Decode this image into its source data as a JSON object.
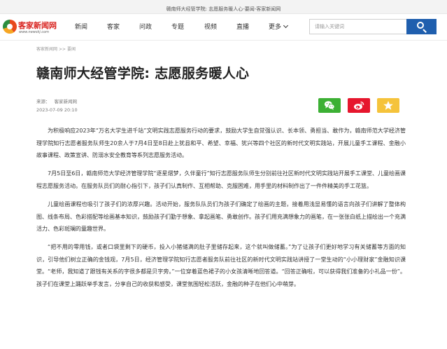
{
  "window_title": "赣南师大经管学院: 志愿服务暖人心-要闻-客家新闻网",
  "logo": {
    "name": "客家新闻网",
    "url": "www.newskj.com"
  },
  "nav": [
    "新闻",
    "客家",
    "问政",
    "专题",
    "视频",
    "直播",
    "更多"
  ],
  "search": {
    "placeholder": "请输入关键词",
    "value": ""
  },
  "breadcrumb": {
    "home": "客家新闻网",
    "separator": ">>",
    "section": "要闻"
  },
  "article": {
    "title": "赣南师大经管学院: 志愿服务暖人心",
    "source_label": "来源：",
    "source": "客家新闻网",
    "date": "2023-07-09 20:10",
    "paragraphs": [
      "为积极响应2023年“万名大学生进千站”文明实践志愿服务行动的要求，鼓励大学生自觉强认识、长本领、勇担当、敢作为，赣南师范大学经济管理学院知行志愿者服务队师生20余人于7月4日至8日赴上犹县和平、希望、幸福、犹兴等四个社区的新时代文明实践站，开展儿童手工课程、金融小故事课程、政策宣讲、防溺水安全教育等系列志愿服务活动。",
      "7月5日至6日，赣南师范大学经济管理学院“逐星熠梦，久伴童行”知行志愿服务队师生分别前往社区新时代文明实践站开展手工课堂、儿童绘画课程志愿服务活动。在服务队员们的耐心指引下，孩子们认真制作、互相帮助、克服困难，用手里的材料制作出了一件件精美的手工花篮。",
      "儿童绘画课程也吸引了孩子们的浓厚兴趣。活动开始，服务队队员们为孩子们确定了绘画的主题，接着用浅显易懂的语言向孩子们讲解了整体构图、线条布局、色彩搭配等绘画基本知识，鼓励孩子们勤于想象、拿起画笔、勇敢创作。孩子们用充满想象力的画笔，在一张张白纸上描绘出一个充满活力、色彩斑斓的童趣世界。",
      "“把不用的零用钱，或者口袋里剩下的硬币，投入小猪储满的肚子里储存起来，这个就叫做储蓄。”为了让孩子们更好地学习有关储蓄等方面的知识，引导他们树立正确的金钱观，7月5日，经济管理学院知行志愿者服务队前往社区的新时代文明实践站讲授了一堂生动的“小小理财家”金融知识课堂。“老师，我知道了跟钱有关系的字很多都是贝字旁。”一位穿着蓝色裙子的小女孩清晰地回答道。“回答正确啦，可以获得我们准备的小礼品一份”。孩子们在课堂上踊跃举手发言，分享自己的收获和感受，课堂氛围轻松活跃，金融的种子在他们心中萌芽。"
    ]
  },
  "colors": {
    "brand_red": "#d8201c",
    "search_blue": "#1f5fae",
    "wechat_green": "#3cb034",
    "weibo_red": "#e6162d",
    "favorite_yellow": "#f5c33b"
  },
  "icons": [
    "wechat-icon",
    "weibo-icon",
    "star-icon",
    "search-icon",
    "chevron-down-icon"
  ]
}
